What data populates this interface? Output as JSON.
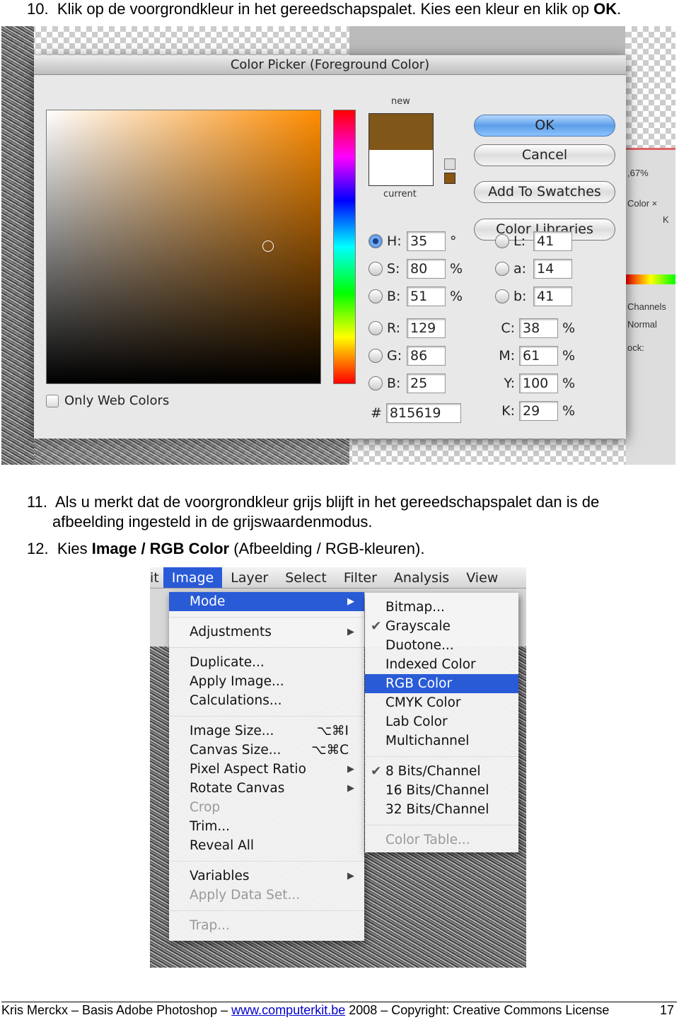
{
  "step10": {
    "number": "10.",
    "text": "Klik op de voorgrondkleur in het gereedschapspalet. Kies een kleur en klik op ",
    "bold": "OK",
    "end": "."
  },
  "color_picker": {
    "title": "Color Picker (Foreground Color)",
    "new_label": "new",
    "current_label": "current",
    "new_color": "#815619",
    "current_color": "#ffffff",
    "buttons": {
      "ok": "OK",
      "cancel": "Cancel",
      "add_to_swatches": "Add To Swatches",
      "color_libraries": "Color Libraries"
    },
    "only_web_colors": "Only Web Colors",
    "hsb": [
      {
        "label": "H:",
        "value": "35",
        "unit": "°",
        "selected": true
      },
      {
        "label": "S:",
        "value": "80",
        "unit": "%"
      },
      {
        "label": "B:",
        "value": "51",
        "unit": "%"
      }
    ],
    "rgb": [
      {
        "label": "R:",
        "value": "129"
      },
      {
        "label": "G:",
        "value": "86"
      },
      {
        "label": "B:",
        "value": "25"
      }
    ],
    "lab": [
      {
        "label": "L:",
        "value": "41"
      },
      {
        "label": "a:",
        "value": "14"
      },
      {
        "label": "b:",
        "value": "41"
      }
    ],
    "cmyk": [
      {
        "label": "C:",
        "value": "38",
        "unit": "%"
      },
      {
        "label": "M:",
        "value": "61",
        "unit": "%"
      },
      {
        "label": "Y:",
        "value": "100",
        "unit": "%"
      },
      {
        "label": "K:",
        "value": "29",
        "unit": "%"
      }
    ],
    "hex_label": "#",
    "hex": "815619",
    "background_panel": {
      "zoom": ",67%",
      "color_tab": "Color ×",
      "k_label": "K",
      "channels": "Channels",
      "normal": "Normal",
      "lock": "ock:"
    }
  },
  "step11": {
    "number": "11.",
    "line1": "Als u merkt dat de voorgrondkleur grijs blijft in het gereedschapspalet dan is de",
    "line2": "afbeelding ingesteld in de grijswaardenmodus."
  },
  "step12": {
    "number": "12.",
    "pre": "Kies ",
    "bold": "Image / RGB Color",
    "post": " (Afbeelding / RGB-kleuren)."
  },
  "menubar": [
    "it",
    "Image",
    "Layer",
    "Select",
    "Filter",
    "Analysis",
    "View"
  ],
  "image_menu": [
    {
      "label": "Mode",
      "submenu": true,
      "highlight": true
    },
    {
      "sep": true
    },
    {
      "label": "Adjustments",
      "submenu": true
    },
    {
      "sep": true
    },
    {
      "label": "Duplicate..."
    },
    {
      "label": "Apply Image..."
    },
    {
      "label": "Calculations..."
    },
    {
      "sep": true
    },
    {
      "label": "Image Size...",
      "shortcut": "⌥⌘I"
    },
    {
      "label": "Canvas Size...",
      "shortcut": "⌥⌘C"
    },
    {
      "label": "Pixel Aspect Ratio",
      "submenu": true
    },
    {
      "label": "Rotate Canvas",
      "submenu": true
    },
    {
      "label": "Crop",
      "disabled": true
    },
    {
      "label": "Trim..."
    },
    {
      "label": "Reveal All"
    },
    {
      "sep": true
    },
    {
      "label": "Variables",
      "submenu": true
    },
    {
      "label": "Apply Data Set...",
      "disabled": true
    },
    {
      "sep": true
    },
    {
      "label": "Trap...",
      "disabled": true
    }
  ],
  "mode_submenu": [
    {
      "label": "Bitmap..."
    },
    {
      "label": "Grayscale",
      "checked": true
    },
    {
      "label": "Duotone..."
    },
    {
      "label": "Indexed Color"
    },
    {
      "label": "RGB Color",
      "highlight": true
    },
    {
      "label": "CMYK Color"
    },
    {
      "label": "Lab Color"
    },
    {
      "label": "Multichannel"
    },
    {
      "sep": true
    },
    {
      "label": "8 Bits/Channel",
      "checked": true
    },
    {
      "label": "16 Bits/Channel"
    },
    {
      "label": "32 Bits/Channel"
    },
    {
      "sep": true
    },
    {
      "label": "Color Table...",
      "disabled": true
    }
  ],
  "footer": {
    "text1": "Kris Merckx – Basis Adobe Photoshop – ",
    "link": "www.computerkit.be",
    "text2": " 2008 – Copyright: Creative Commons License",
    "page": "17"
  }
}
